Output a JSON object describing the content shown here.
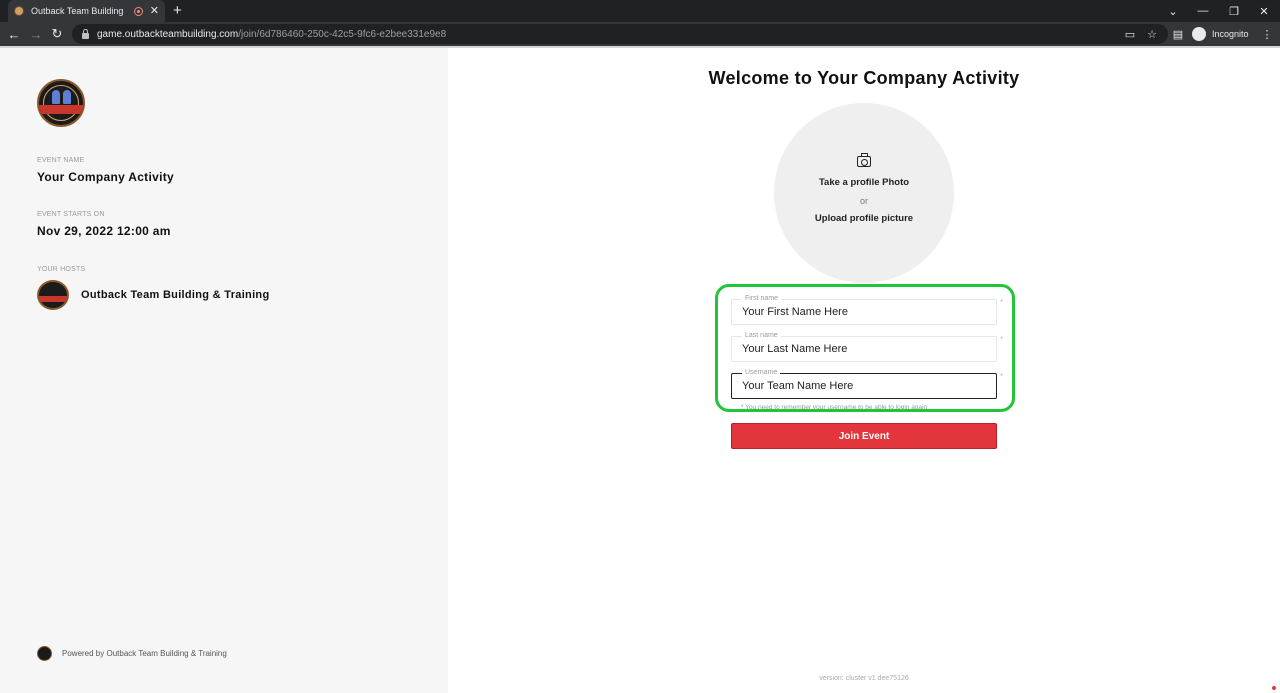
{
  "browser": {
    "tab_title": "Outback Team Building",
    "tab_close": "✕",
    "new_tab": "+",
    "url_host": "game.outbackteambuilding.com",
    "url_path": "/join/6d786460-250c-42c5-9fc6-e2bee331e9e8",
    "incognito_label": "Incognito",
    "window_controls": {
      "chevron": "⌄",
      "minimize": "—",
      "restore": "❐",
      "close": "✕"
    },
    "nav": {
      "back": "←",
      "forward": "→",
      "reload": "↻"
    },
    "toolbar_icons": {
      "camera": "▭",
      "bookmark": "☆",
      "sidepanel": "▤",
      "menu": "⋮"
    }
  },
  "sidebar": {
    "event_name_label": "EVENT NAME",
    "event_name": "Your Company Activity",
    "event_starts_label": "EVENT STARTS ON",
    "event_starts": "Nov 29, 2022 12:00 am",
    "hosts_label": "YOUR HOSTS",
    "host_name": "Outback Team Building & Training",
    "powered_by": "Powered by Outback Team Building & Training"
  },
  "main": {
    "title": "Welcome to Your Company Activity",
    "take_photo": "Take a profile Photo",
    "or": "or",
    "upload_picture": "Upload profile picture",
    "form": {
      "first_name_label": "First name",
      "first_name_value": "Your First Name Here",
      "last_name_label": "Last name",
      "last_name_value": "Your Last Name Here",
      "username_label": "Username",
      "username_value": "Your Team Name Here",
      "required_mark": "*",
      "helper_text": "* You need to remember your username to be able to login again",
      "join_button": "Join Event"
    },
    "version": "version: cluster v1 dee75126"
  },
  "colors": {
    "highlight": "#22c53a",
    "join_button": "#e2363c",
    "sidebar_bg": "#f6f6f6"
  }
}
